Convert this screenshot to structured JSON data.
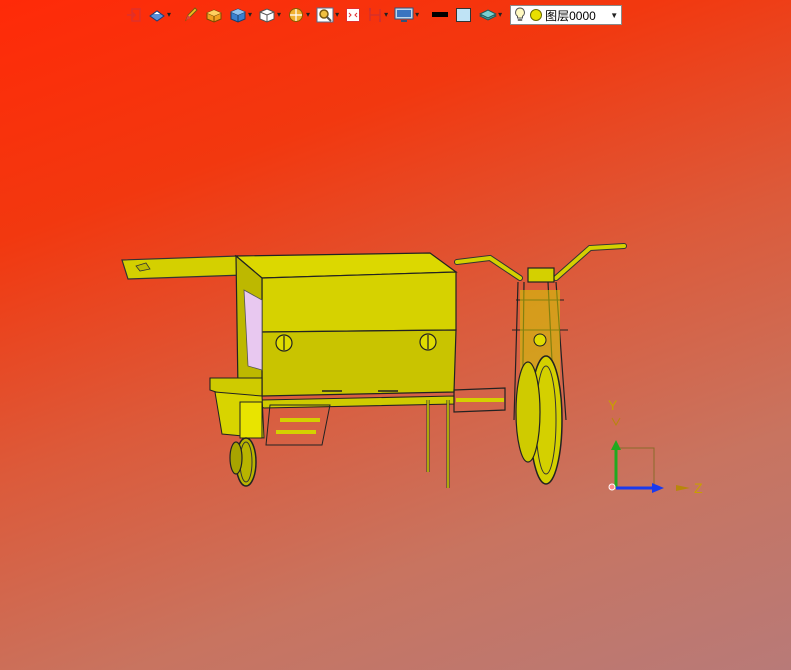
{
  "toolbar": {
    "items": [
      {
        "name": "exit",
        "icon": "exit-icon",
        "has_dropdown": false
      },
      {
        "name": "view-mode",
        "icon": "view-mode-icon",
        "has_dropdown": true
      },
      {
        "name": "sketch",
        "icon": "pencil-icon",
        "has_dropdown": false
      },
      {
        "name": "solid",
        "icon": "solid-box-icon",
        "has_dropdown": false
      },
      {
        "name": "shaded",
        "icon": "shaded-cube-icon",
        "has_dropdown": true
      },
      {
        "name": "view-cube",
        "icon": "view-cube-icon",
        "has_dropdown": true
      },
      {
        "name": "render",
        "icon": "render-sphere-icon",
        "has_dropdown": true
      },
      {
        "name": "zoom",
        "icon": "zoom-icon",
        "has_dropdown": true
      },
      {
        "name": "fit",
        "icon": "fit-view-icon",
        "has_dropdown": false
      },
      {
        "name": "section",
        "icon": "section-icon",
        "has_dropdown": true
      },
      {
        "name": "display",
        "icon": "display-monitor-icon",
        "has_dropdown": true
      },
      {
        "name": "line-color",
        "icon": "line-color-icon",
        "has_dropdown": false
      },
      {
        "name": "face-color",
        "icon": "face-color-icon",
        "has_dropdown": false
      },
      {
        "name": "layers",
        "icon": "layers-icon",
        "has_dropdown": true
      }
    ],
    "layer": {
      "name": "图层0000",
      "bulb_icon": "lightbulb-icon",
      "status_icon": "layer-circle-icon"
    }
  },
  "axes": {
    "y_label": "Y",
    "z_label": "Z"
  },
  "colors": {
    "model": "#d4d000",
    "model_dark": "#8a8400",
    "background_top": "#ff2a08",
    "background_bottom": "#b87a78",
    "axis_y": "#1faa1f",
    "axis_z": "#1a3aee",
    "axis_label": "#c8a000"
  }
}
